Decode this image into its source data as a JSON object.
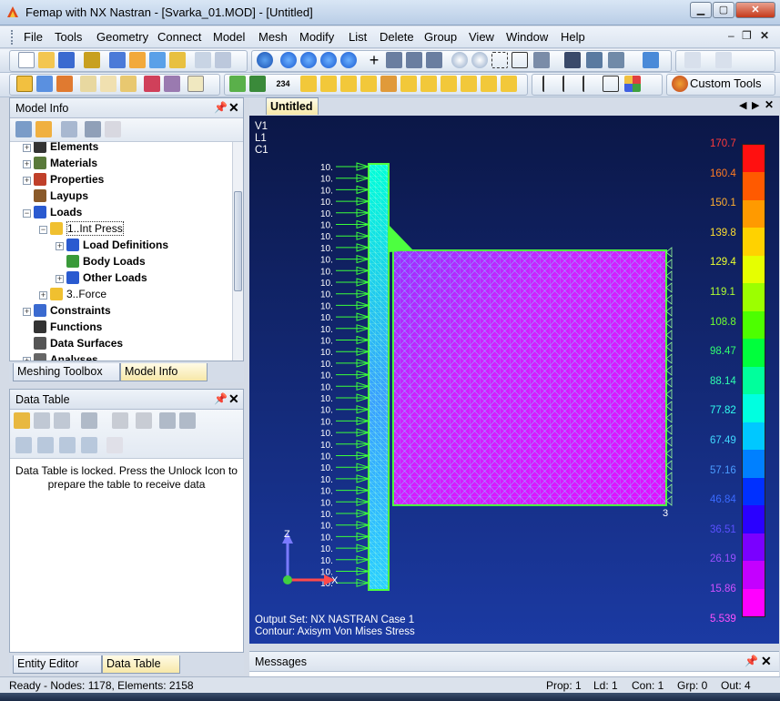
{
  "window": {
    "title": "Femap with NX Nastran - [Svarka_01.MOD] - [Untitled]"
  },
  "menubar": {
    "items": [
      "File",
      "Tools",
      "Geometry",
      "Connect",
      "Model",
      "Mesh",
      "Modify",
      "List",
      "Delete",
      "Group",
      "View",
      "Window",
      "Help"
    ]
  },
  "toolbar": {
    "custom_tools_label": "Custom Tools",
    "number_icon_label": "234"
  },
  "model_info": {
    "title": "Model Info",
    "tree": [
      {
        "label": "Elements",
        "icon": "elements-icon",
        "level": 0
      },
      {
        "label": "Materials",
        "icon": "materials-icon",
        "level": 0
      },
      {
        "label": "Properties",
        "icon": "properties-icon",
        "level": 0
      },
      {
        "label": "Layups",
        "icon": "layups-icon",
        "level": 0
      },
      {
        "label": "Loads",
        "icon": "loads-icon",
        "level": 0
      },
      {
        "label": "1..Int Press",
        "icon": "loadset-icon",
        "level": 1
      },
      {
        "label": "Load Definitions",
        "icon": "load-definitions-icon",
        "level": 2
      },
      {
        "label": "Body Loads",
        "icon": "body-loads-icon",
        "level": 2
      },
      {
        "label": "Other Loads",
        "icon": "other-loads-icon",
        "level": 2
      },
      {
        "label": "3..Force",
        "icon": "loadset-icon",
        "level": 1
      },
      {
        "label": "Constraints",
        "icon": "constraints-icon",
        "level": 0
      },
      {
        "label": "Functions",
        "icon": "functions-icon",
        "level": 0
      },
      {
        "label": "Data Surfaces",
        "icon": "data-surfaces-icon",
        "level": 0
      },
      {
        "label": "Analyses",
        "icon": "analyses-icon",
        "level": 0
      }
    ],
    "tabs": [
      "Meshing Toolbox",
      "Model Info"
    ]
  },
  "data_table": {
    "title": "Data Table",
    "message": "Data Table is locked. Press the Unlock Icon to prepare the table to receive data",
    "tabs": [
      "Entity Editor",
      "Data Table"
    ]
  },
  "graphics": {
    "tab_label": "Untitled",
    "view_labels": [
      "V1",
      "L1",
      "C1"
    ],
    "output_set": "Output Set: NX NASTRAN Case 1",
    "contour": "Contour: Axisym Von Mises Stress",
    "load_label": "10.",
    "node_label": "3",
    "axis_z": "Z",
    "axis_x": "X",
    "legend": {
      "values": [
        "170.7",
        "160.4",
        "150.1",
        "139.8",
        "129.4",
        "119.1",
        "108.8",
        "98.47",
        "88.14",
        "77.82",
        "67.49",
        "57.16",
        "46.84",
        "36.51",
        "26.19",
        "15.86",
        "5.539"
      ],
      "colors": [
        "#ff1010",
        "#ff5a00",
        "#ff9a00",
        "#ffd200",
        "#e6ff00",
        "#9cff00",
        "#4dff00",
        "#00ff3c",
        "#00ff9c",
        "#00ffe0",
        "#00c8ff",
        "#0080ff",
        "#0030ff",
        "#2a00ff",
        "#7a00ff",
        "#c400ff",
        "#ff00ff"
      ],
      "label_colors": [
        "#ff3a3a",
        "#ff7a22",
        "#ffae30",
        "#ffdf30",
        "#eaff30",
        "#b0ff30",
        "#70ff30",
        "#30ff70",
        "#30ffb0",
        "#30fff0",
        "#40d8ff",
        "#4a9cff",
        "#3a6aff",
        "#5a50ff",
        "#9a50ff",
        "#d050ff",
        "#ff50ff"
      ]
    }
  },
  "messages": {
    "title": "Messages"
  },
  "status": {
    "left": "Ready - Nodes: 1178,  Elements: 2158",
    "prop": "Prop: 1",
    "ld": "Ld: 1",
    "con": "Con: 1",
    "grp": "Grp: 0",
    "out": "Out: 4"
  }
}
